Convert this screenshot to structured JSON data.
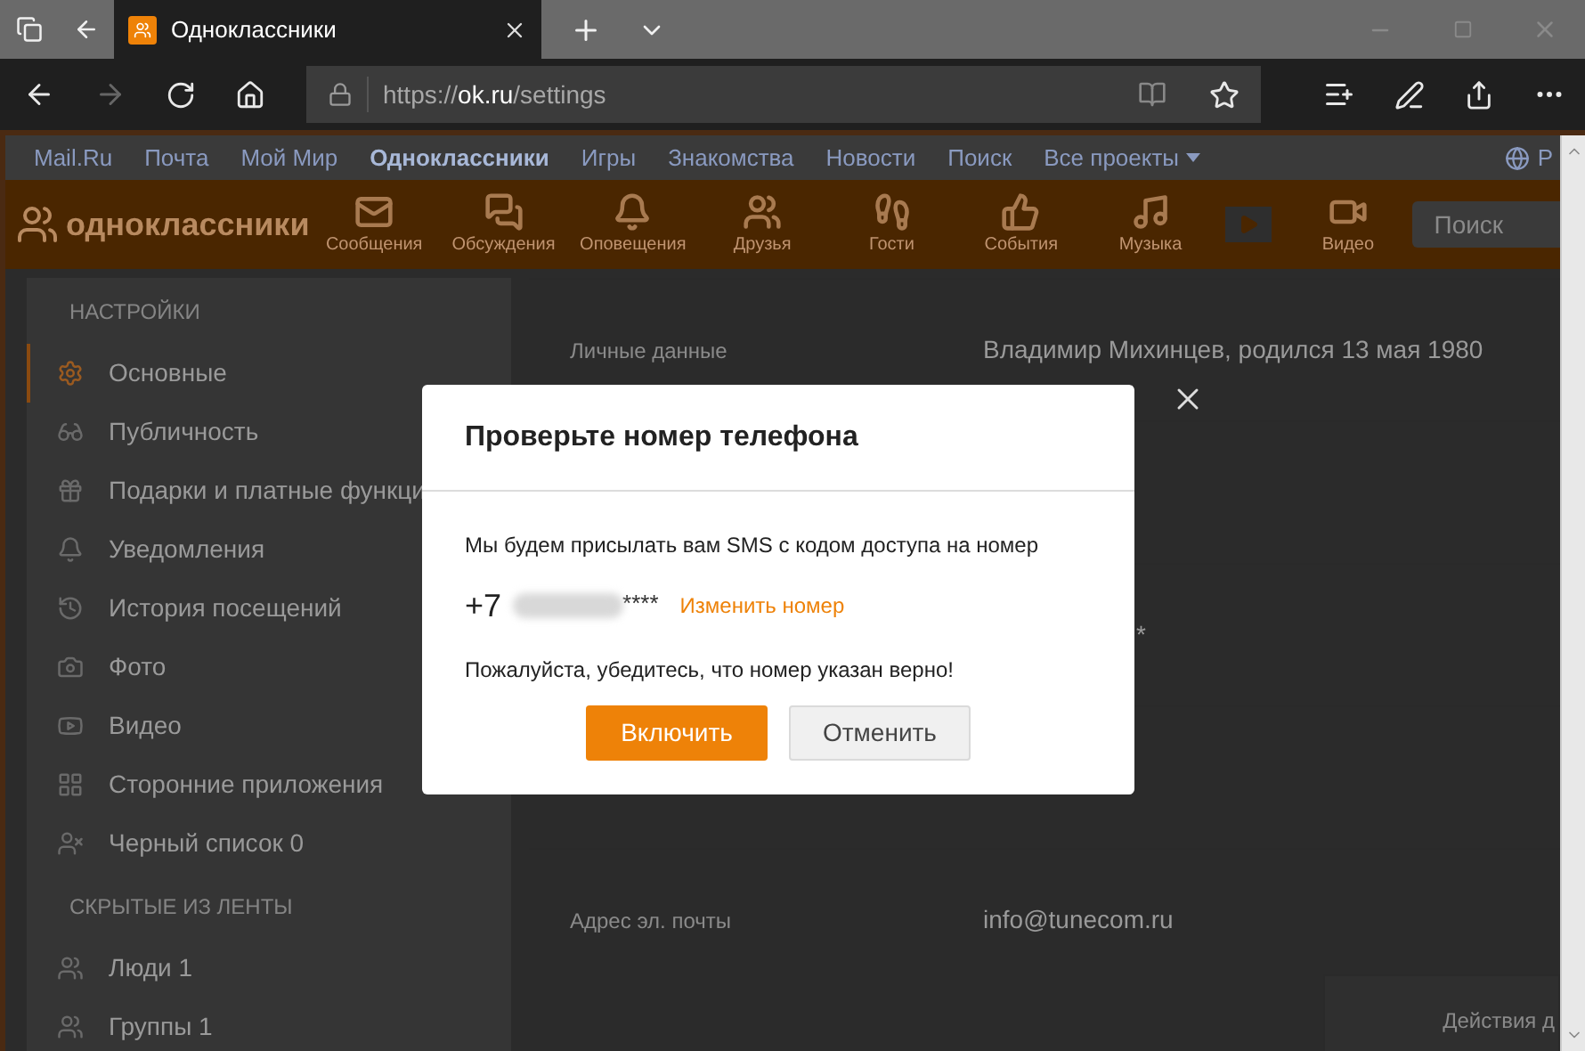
{
  "browser": {
    "tab_title": "Одноклассники",
    "url_parts": [
      {
        "text": "https://",
        "kind": "dim"
      },
      {
        "text": "ok.ru",
        "kind": "host"
      },
      {
        "text": "/settings",
        "kind": "dim"
      }
    ]
  },
  "portal_nav": {
    "items": [
      {
        "label": "Mail.Ru",
        "selected": false,
        "dropdown": false
      },
      {
        "label": "Почта",
        "selected": false,
        "dropdown": false
      },
      {
        "label": "Мой Мир",
        "selected": false,
        "dropdown": false
      },
      {
        "label": "Одноклассники",
        "selected": true,
        "dropdown": false
      },
      {
        "label": "Игры",
        "selected": false,
        "dropdown": false
      },
      {
        "label": "Знакомства",
        "selected": false,
        "dropdown": false
      },
      {
        "label": "Новости",
        "selected": false,
        "dropdown": false
      },
      {
        "label": "Поиск",
        "selected": false,
        "dropdown": false
      },
      {
        "label": "Все проекты",
        "selected": false,
        "dropdown": true
      }
    ],
    "cut_text": "Р"
  },
  "main_nav": {
    "logo_text": "одноклассники",
    "items": [
      {
        "kind": "messages",
        "label": "Сообщения"
      },
      {
        "kind": "discussions",
        "label": "Обсуждения"
      },
      {
        "kind": "notifications",
        "label": "Оповещения"
      },
      {
        "kind": "friends",
        "label": "Друзья"
      },
      {
        "kind": "guests",
        "label": "Гости"
      },
      {
        "kind": "events",
        "label": "События"
      },
      {
        "kind": "music",
        "label": "Музыка"
      },
      {
        "kind": "player"
      },
      {
        "kind": "video",
        "label": "Видео"
      }
    ],
    "search": {
      "placeholder": "Поиск"
    }
  },
  "sidebar": {
    "sections": [
      {
        "heading": "НАСТРОЙКИ",
        "items": [
          {
            "label": "Основные",
            "selected": true
          },
          {
            "label": "Публичность",
            "selected": false
          },
          {
            "label": "Подарки и платные функци",
            "selected": false
          },
          {
            "label": "Уведомления",
            "selected": false
          },
          {
            "label": "История посещений",
            "selected": false
          },
          {
            "label": "Фото",
            "selected": false
          },
          {
            "label": "Видео",
            "selected": false
          },
          {
            "label": "Сторонние приложения",
            "selected": false
          },
          {
            "label": "Черный список",
            "count": "0",
            "selected": false
          }
        ]
      },
      {
        "heading": "СКРЫТЫЕ ИЗ ЛЕНТЫ",
        "items": [
          {
            "label": "Люди",
            "count": "1",
            "selected": false
          },
          {
            "label": "Группы",
            "count": "1",
            "selected": false
          }
        ]
      }
    ]
  },
  "settings_rows": [
    {
      "label": "Личные данные",
      "value": "Владимир Михинцев, родился 13 мая 1980"
    },
    {},
    {
      "value": "*"
    },
    {},
    {
      "label": "Адрес эл. почты",
      "value": "info@tunecom.ru"
    }
  ],
  "actions_panel": {
    "text": "Действия д"
  },
  "modal": {
    "title": "Проверьте номер телефона",
    "message": "Мы будем присылать вам SMS с кодом доступа на номер",
    "phone_prefix": "+7",
    "phone_suffix": "****",
    "change_link": "Изменить номер",
    "warning": "Пожалуйста, убедитесь, что номер указан верно!",
    "buttons": [
      {
        "label": "Включить",
        "kind": "primary"
      },
      {
        "label": "Отменить",
        "kind": "secondary"
      }
    ]
  }
}
